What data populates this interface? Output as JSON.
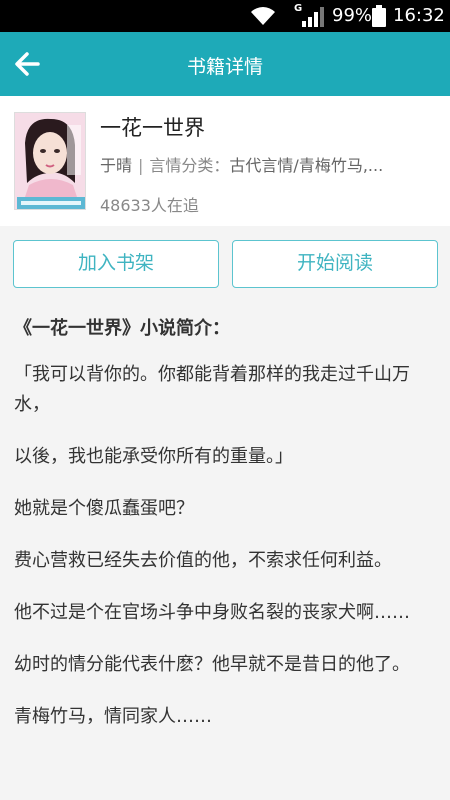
{
  "status_bar": {
    "network_type": "G",
    "battery_percent": "99%",
    "time": "16:32",
    "icons": [
      "wifi-icon",
      "cell-signal-icon",
      "battery-icon"
    ]
  },
  "app_bar": {
    "title": "书籍详情",
    "back_icon": "back-arrow-icon",
    "color": "#1eaab8"
  },
  "book": {
    "title": "一花一世界",
    "author": "于晴",
    "category_label": "言情分类：",
    "category_value": "古代言情/青梅竹马,...",
    "followers": "48633人在追",
    "cover_icon": "book-cover-image"
  },
  "actions": {
    "add_to_shelf": "加入书架",
    "start_reading": "开始阅读",
    "accent": "#3fb4c1"
  },
  "intro": {
    "heading": "《一花一世界》小说简介：",
    "paragraphs": [
      "「我可以背你的。你都能背着那样的我走过千山万水，",
      "以後，我也能承受你所有的重量。」",
      "她就是个傻瓜蠢蛋吧？",
      "费心营救已经失去价值的他，不索求任何利益。",
      "他不过是个在官场斗争中身败名裂的丧家犬啊……",
      "幼时的情分能代表什麽？他早就不是昔日的他了。",
      "青梅竹马，情同家人……"
    ]
  }
}
